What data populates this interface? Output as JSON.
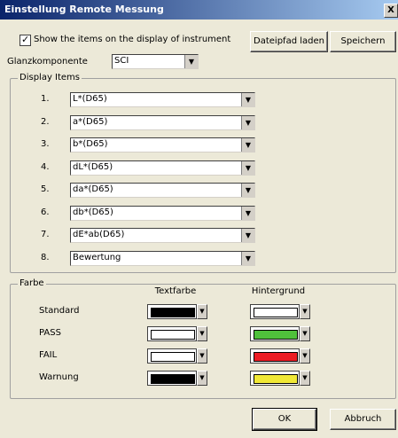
{
  "window": {
    "title": "Einstellung Remote Messung",
    "close_label": "X"
  },
  "show_items": {
    "label": "Show the items on the display of instrument",
    "checked": true
  },
  "buttons": {
    "load_path": "Dateipfad laden",
    "save": "Speichern",
    "ok": "OK",
    "cancel": "Abbruch"
  },
  "glanz": {
    "label": "Glanzkomponente",
    "value": "SCI"
  },
  "display_items": {
    "legend": "Display Items",
    "rows": [
      {
        "num": "1.",
        "value": "L*(D65)"
      },
      {
        "num": "2.",
        "value": "a*(D65)"
      },
      {
        "num": "3.",
        "value": "b*(D65)"
      },
      {
        "num": "4.",
        "value": "dL*(D65)"
      },
      {
        "num": "5.",
        "value": "da*(D65)"
      },
      {
        "num": "6.",
        "value": "db*(D65)"
      },
      {
        "num": "7.",
        "value": "dE*ab(D65)"
      },
      {
        "num": "8.",
        "value": "Bewertung"
      }
    ]
  },
  "farbe": {
    "legend": "Farbe",
    "col_text": "Textfarbe",
    "col_bg": "Hintergrund",
    "rows": [
      {
        "label": "Standard",
        "text_color": "#000000",
        "bg_color": "#ffffff"
      },
      {
        "label": "PASS",
        "text_color": "#ffffff",
        "bg_color": "#4fc13b"
      },
      {
        "label": "FAIL",
        "text_color": "#ffffff",
        "bg_color": "#ec1c24"
      },
      {
        "label": "Warnung",
        "text_color": "#000000",
        "bg_color": "#f0e836"
      }
    ]
  },
  "icons": {
    "dropdown": "chevron-down-icon",
    "check": "check-icon",
    "close": "close-icon"
  }
}
